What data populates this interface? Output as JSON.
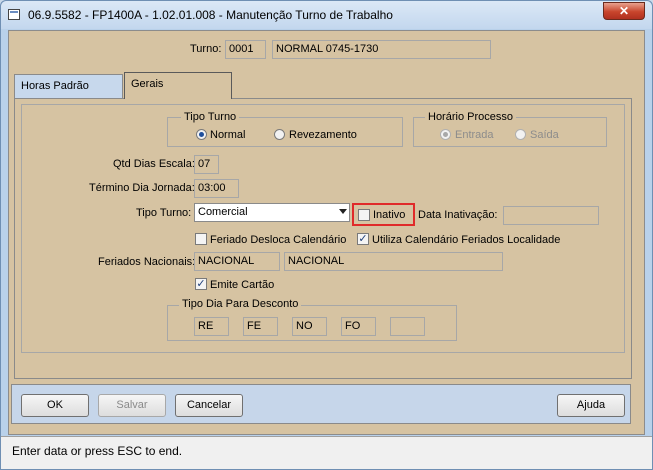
{
  "window": {
    "title": "06.9.5582 - FP1400A - 1.02.01.008 - Manutenção Turno de Trabalho",
    "close_glyph": "✕"
  },
  "header": {
    "turno_label": "Turno:",
    "turno_code": "0001",
    "turno_description": "NORMAL 0745-1730"
  },
  "tabs": [
    {
      "label": "Horas Padrão",
      "active": false
    },
    {
      "label": "Gerais",
      "active": true
    }
  ],
  "tipo_turno_group": {
    "title": "Tipo Turno",
    "options": [
      {
        "label": "Normal",
        "selected": true
      },
      {
        "label": "Revezamento",
        "selected": false
      }
    ]
  },
  "horario_processo_group": {
    "title": "Horário Processo",
    "options": [
      {
        "label": "Entrada",
        "selected": true,
        "enabled": false
      },
      {
        "label": "Saída",
        "selected": false,
        "enabled": false
      }
    ]
  },
  "form": {
    "qtd_dias_escala_label": "Qtd Dias Escala:",
    "qtd_dias_escala_value": "07",
    "termino_dia_jornada_label": "Término Dia Jornada:",
    "termino_dia_jornada_value": "03:00",
    "tipo_turno_label": "Tipo Turno:",
    "tipo_turno_value": "Comercial",
    "inativo_label": "Inativo",
    "inativo_checked": false,
    "data_inativacao_label": "Data Inativação:",
    "data_inativacao_value": "",
    "feriado_desloca_label": "Feriado Desloca Calendário",
    "feriado_desloca_checked": false,
    "utiliza_calendario_label": "Utiliza Calendário Feriados Localidade",
    "utiliza_calendario_checked": true,
    "feriados_nacionais_label": "Feriados Nacionais:",
    "feriados_nacionais_code": "NACIONAL",
    "feriados_nacionais_desc": "NACIONAL",
    "emite_cartao_label": "Emite Cartão",
    "emite_cartao_checked": true
  },
  "tipo_dia_desconto": {
    "title": "Tipo Dia Para Desconto",
    "values": [
      "RE",
      "FE",
      "NO",
      "FO",
      ""
    ]
  },
  "buttons": {
    "ok": "OK",
    "salvar": "Salvar",
    "cancelar": "Cancelar",
    "ajuda": "Ajuda"
  },
  "status": {
    "text": "Enter data or press ESC to end."
  },
  "colors": {
    "form_background": "#d6c3a2",
    "highlight": "#e02a2a",
    "window_frame": "#b9d1ea"
  }
}
